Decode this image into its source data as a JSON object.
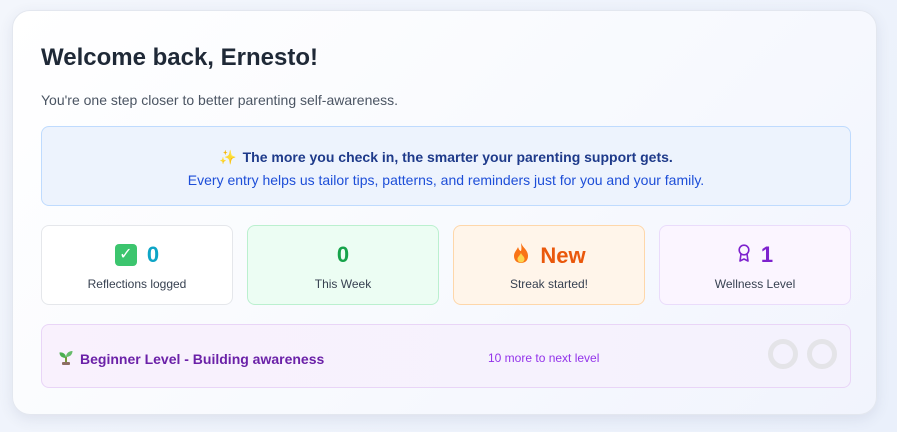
{
  "header": {
    "title": "Welcome back, Ernesto!",
    "subtitle": "You're one step closer to better parenting self-awareness."
  },
  "banner": {
    "icon": "sparkles-icon",
    "headline": "The more you check in, the smarter your parenting support gets.",
    "body": "Every entry helps us tailor tips, patterns, and reminders just for you and your family."
  },
  "stats": [
    {
      "icon": "checkmark-box-icon",
      "value": "0",
      "label": "Reflections logged",
      "color": "#0ea5c6"
    },
    {
      "icon": "",
      "value": "0",
      "label": "This Week",
      "color": "#16a34a"
    },
    {
      "icon": "fire-icon",
      "value": "New",
      "label": "Streak started!",
      "color": "#ea580c"
    },
    {
      "icon": "award-ribbon-icon",
      "value": "1",
      "label": "Wellness Level",
      "color": "#7e22ce"
    }
  ],
  "level": {
    "icon": "seedling-icon",
    "title": "Beginner Level - Building awareness",
    "next": "10 more to next level",
    "progress_dots_filled": 0,
    "progress_dots_total": 2
  }
}
